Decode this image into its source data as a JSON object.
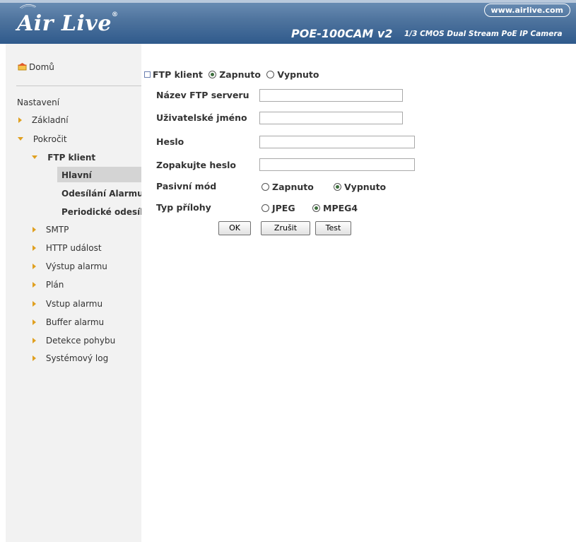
{
  "header": {
    "brand": "Air Live",
    "url": "www.airlive.com",
    "model": "POE-100CAM v2",
    "model_description": "1/3 CMOS Dual Stream PoE IP Camera"
  },
  "sidebar": {
    "home": "Domů",
    "heading": "Nastavení",
    "items": [
      {
        "label": "Základní",
        "icon": "triangle-right-icon"
      },
      {
        "label": "Pokročit",
        "icon": "triangle-down-icon"
      },
      {
        "label": "FTP klient",
        "icon": "triangle-down-icon"
      },
      {
        "label": "Hlavní"
      },
      {
        "label": "Odesílání Alarmu"
      },
      {
        "label": "Periodické odesílání"
      },
      {
        "label": "SMTP",
        "icon": "triangle-right-icon"
      },
      {
        "label": "HTTP událost",
        "icon": "triangle-right-icon"
      },
      {
        "label": "Výstup alarmu",
        "icon": "triangle-right-icon"
      },
      {
        "label": "Plán",
        "icon": "triangle-right-icon"
      },
      {
        "label": "Vstup alarmu",
        "icon": "triangle-right-icon"
      },
      {
        "label": "Buffer alarmu",
        "icon": "triangle-right-icon"
      },
      {
        "label": "Detekce pohybu",
        "icon": "triangle-right-icon"
      },
      {
        "label": "Systémový log",
        "icon": "triangle-right-icon"
      }
    ],
    "active_item": "Hlavní"
  },
  "form": {
    "section_title": "FTP klient",
    "ftp_on": "Zapnuto",
    "ftp_off": "Vypnuto",
    "ftp_selected": "Zapnuto",
    "server_label": "Název FTP serveru",
    "server_value": "",
    "user_label": "Uživatelské jméno",
    "user_value": "",
    "password_label": "Heslo",
    "password_value": "",
    "password_confirm_label": "Zopakujte heslo",
    "password_confirm_value": "",
    "passive_label": "Pasivní mód",
    "passive_on": "Zapnuto",
    "passive_off": "Vypnuto",
    "passive_selected": "Vypnuto",
    "attach_label": "Typ přílohy",
    "attach_jpeg": "JPEG",
    "attach_mpeg4": "MPEG4",
    "attach_selected": "MPEG4",
    "ok_button": "OK",
    "cancel_button": "Zrušit",
    "test_button": "Test"
  },
  "colors": {
    "header": "#4f749e",
    "sidebar": "#f2f2f2",
    "active_item": "#d4d4d4",
    "nav_arrow": "#e0a020"
  }
}
